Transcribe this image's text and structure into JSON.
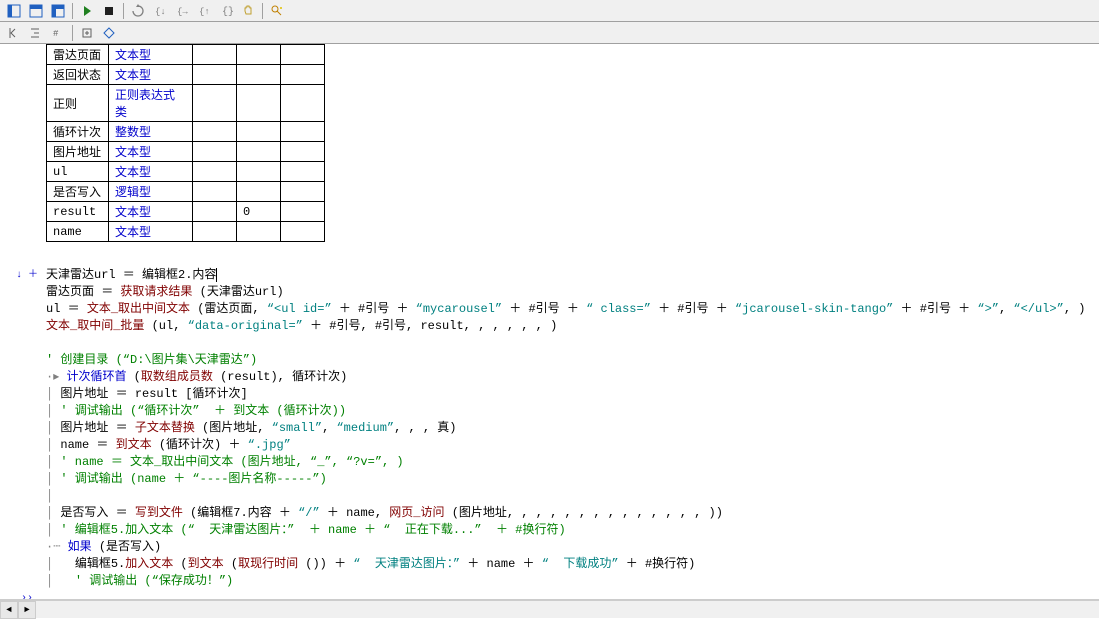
{
  "toolbar_icons": {
    "layout1": "layout-left-icon",
    "layout2": "layout-top-icon",
    "layout3": "layout-both-icon",
    "play": "play-icon",
    "stop": "stop-icon",
    "reload": "reload-icon",
    "stepinto": "step-into-icon",
    "stepover": "step-over-icon",
    "stepout": "step-out-icon",
    "braces": "braces-icon",
    "hand": "hand-icon",
    "search": "search-icon"
  },
  "table": {
    "rows": [
      {
        "name": "雷达页面",
        "type": "文本型",
        "init": ""
      },
      {
        "name": "返回状态",
        "type": "文本型",
        "init": ""
      },
      {
        "name": "正则",
        "type": "正则表达式类",
        "init": ""
      },
      {
        "name": "循环计次",
        "type": "整数型",
        "init": ""
      },
      {
        "name": "图片地址",
        "type": "文本型",
        "init": ""
      },
      {
        "name": "ul",
        "type": "文本型",
        "init": ""
      },
      {
        "name": "是否写入",
        "type": "逻辑型",
        "init": ""
      },
      {
        "name": "result",
        "type": "文本型",
        "init": "0"
      },
      {
        "name": "name",
        "type": "文本型",
        "init": ""
      }
    ]
  },
  "gutter": {
    "down": "↓",
    "plus": "＋",
    "dblright": "››"
  },
  "code": {
    "l1_var": "天津雷达url",
    "l1_op": " ＝ ",
    "l1_rhs": "编辑框2.内容",
    "l2_var": "雷达页面",
    "l2_op": " ＝ ",
    "l2_fn": "获取请求结果",
    "l2_args": " (天津雷达url)",
    "l3_var": "ul",
    "l3_op": " ＝ ",
    "l3_fn": "文本_取出中间文本",
    "l3_a1": " (雷达页面, ",
    "l3_s1": "“<ul id=”",
    "l3_p1": " ＋ #引号 ＋ ",
    "l3_s2": "“mycarousel”",
    "l3_p2": " ＋ #引号 ＋ ",
    "l3_s3": "“ class=”",
    "l3_p3": " ＋ #引号 ＋ ",
    "l3_s4": "“jcarousel-skin-tango”",
    "l3_p4": " ＋ #引号 ＋ ",
    "l3_s5": "“>”",
    "l3_c1": ", ",
    "l3_s6": "“</ul>”",
    "l3_end": ", )",
    "l4_fn": "文本_取中间_批量",
    "l4_a1": " (ul, ",
    "l4_s1": "“data-original=”",
    "l4_p1": " ＋ #引号, #引号, result, , , , , , )",
    "l6_cmt": "' 创建目录 (“D:\\图片集\\天津雷达”)",
    "l7_tree": "·▸ ",
    "l7_fn": "计次循环首",
    "l7_args_open": " (",
    "l7_fn2": "取数组成员数",
    "l7_args": " (result), 循环计次)",
    "l8_tree": "│ ",
    "l8_var": "图片地址",
    "l8_op": " ＝ ",
    "l8_rhs": "result [循环计次]",
    "l9_cmt": "' 调试输出 (“循环计次”  ＋ 到文本 (循环计次))",
    "l10_var": "图片地址",
    "l10_op": " ＝ ",
    "l10_fn": "子文本替换",
    "l10_a": " (图片地址, ",
    "l10_s1": "“small”",
    "l10_c": ", ",
    "l10_s2": "“medium”",
    "l10_t": ", , , 真)",
    "l11_var": "name",
    "l11_op": " ＝ ",
    "l11_fn": "到文本",
    "l11_a": " (循环计次) ＋ ",
    "l11_s": "“.jpg”",
    "l12_cmt": "' name ＝ 文本_取出中间文本 (图片地址, “_”, “?v=”, )",
    "l13_cmt": "' 调试输出 (name ＋ “----图片名称-----”)",
    "l15_var": "是否写入",
    "l15_op": " ＝ ",
    "l15_fn": "写到文件",
    "l15_a1": " (编辑框7.内容 ＋ ",
    "l15_s1": "“/”",
    "l15_p1": " ＋ name, ",
    "l15_fn2": "网页_访问",
    "l15_a2": " (图片地址, , , , , , , , , , , , , , ))",
    "l16_cmt_a": "' 编辑框5.加入文本 (“  天津雷达图片：”  ＋ name ＋ “  正在下载...”  ＋ #换行符)",
    "l17_tree": "·┄ ",
    "l17_fn": "如果",
    "l17_arg": " (是否写入)",
    "l18_tree": "│ ",
    "l18_a": "编辑框5.",
    "l18_fn": "加入文本",
    "l18_open": " (",
    "l18_fn2": "到文本",
    "l18_b": " (",
    "l18_fn3": "取现行时间",
    "l18_c": " ()) ＋ ",
    "l18_s1": "“  天津雷达图片：”",
    "l18_p1": " ＋ name ＋ ",
    "l18_s2": "“  下载成功”",
    "l18_p2": " ＋ #换行符)",
    "l19_cmt": "' 调试输出 (“保存成功！”)"
  }
}
